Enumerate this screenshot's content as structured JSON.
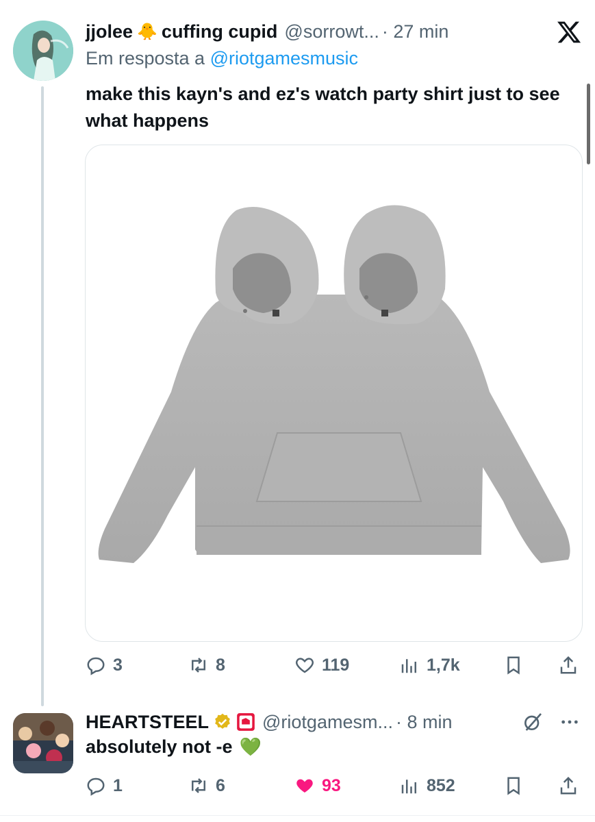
{
  "tweet": {
    "author": {
      "display_name": "jjolee",
      "emoji": "🐥",
      "name_suffix": "cuffing cupid",
      "handle": "@sorrowt...",
      "time": "· 27 min"
    },
    "reply_prefix": "Em resposta a",
    "reply_to": "@riotgamesmusic",
    "text": "make this kayn's and ez's watch party shirt just to see what happens",
    "stats": {
      "replies": "3",
      "retweets": "8",
      "likes": "119",
      "views": "1,7k"
    }
  },
  "reply": {
    "author": {
      "display_name": "HEARTSTEEL",
      "handle": "@riotgamesm...",
      "time": "· 8 min"
    },
    "text": "absolutely not -e",
    "emoji": "💚",
    "stats": {
      "replies": "1",
      "retweets": "6",
      "likes": "93",
      "views": "852"
    }
  },
  "colors": {
    "accent": "#1d9bf0",
    "muted": "#536471",
    "like_active": "#f91880",
    "verified_gold": "#e2b719",
    "badge_red": "#e5173f"
  },
  "icons": [
    "x-logo-icon",
    "reply-icon",
    "retweet-icon",
    "like-icon",
    "views-icon",
    "bookmark-icon",
    "share-icon",
    "verified-gold-icon",
    "riot-badge-icon",
    "grok-icon",
    "more-icon"
  ]
}
